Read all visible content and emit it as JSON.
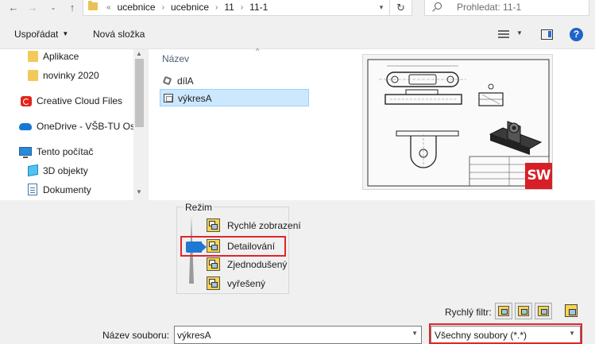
{
  "address": {
    "overflow": "«",
    "breadcrumbs": [
      "ucebnice",
      "ucebnice",
      "11",
      "11-1"
    ],
    "search_placeholder": "Prohledat: 11-1"
  },
  "toolbar": {
    "organize_label": "Uspořádat",
    "new_folder_label": "Nová složka",
    "help_label": "?"
  },
  "nav": {
    "items": [
      {
        "label": "Aplikace",
        "icon": "folder-icon"
      },
      {
        "label": "novinky 2020",
        "icon": "folder-icon"
      },
      {
        "label": "Creative Cloud Files",
        "icon": "creative-cloud-icon"
      },
      {
        "label": "OneDrive - VŠB-TU Ost",
        "icon": "onedrive-icon"
      },
      {
        "label": "Tento počítač",
        "icon": "computer-icon"
      },
      {
        "label": "3D objekty",
        "icon": "3d-objects-icon"
      },
      {
        "label": "Dokumenty",
        "icon": "documents-icon"
      }
    ]
  },
  "files": {
    "column_name": "Název",
    "items": [
      {
        "label": "dílA",
        "icon": "part-file-icon",
        "selected": false
      },
      {
        "label": "výkresA",
        "icon": "drawing-file-icon",
        "selected": true
      }
    ]
  },
  "preview": {
    "logo_text": "SW"
  },
  "mode": {
    "label": "Režim",
    "options": [
      {
        "label": "Rychlé zobrazení",
        "selected": false
      },
      {
        "label": "Detailování",
        "selected": true
      },
      {
        "label": "Zjednodušený",
        "selected": false
      },
      {
        "label": "vyřešený",
        "selected": false
      }
    ]
  },
  "quick_filter": {
    "label": "Rychlý filtr:"
  },
  "filename": {
    "label": "Název souboru:",
    "value": "výkresA"
  },
  "file_type": {
    "value": "Všechny soubory (*.*)"
  },
  "colors": {
    "highlight": "#e0262a",
    "selection": "#cce8ff",
    "accent": "#1f78d1",
    "solidworks": "#d61f26"
  }
}
